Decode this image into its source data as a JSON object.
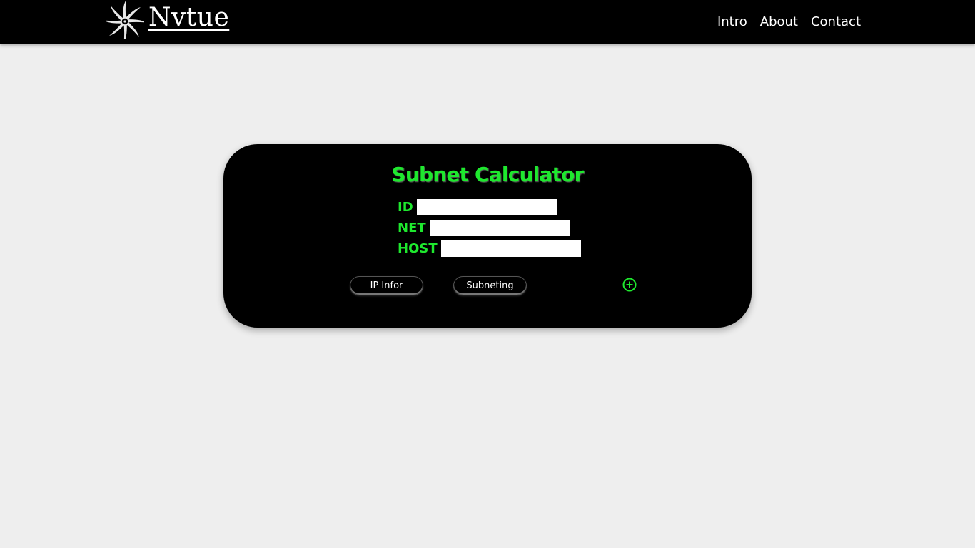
{
  "header": {
    "brand_name": "Nvtue",
    "nav": [
      {
        "label": "Intro"
      },
      {
        "label": "About"
      },
      {
        "label": "Contact"
      }
    ]
  },
  "calculator": {
    "title": "Subnet Calculator",
    "fields": [
      {
        "label": "ID",
        "value": ""
      },
      {
        "label": "NET",
        "value": ""
      },
      {
        "label": "HOST",
        "value": ""
      }
    ],
    "buttons": {
      "ip_info": "IP Infor",
      "subneting": "Subneting"
    },
    "add_icon": "plus-circle-icon"
  },
  "colors": {
    "accent": "#1ee82e",
    "page_background": "#eeeeee",
    "header_background": "#000000",
    "card_background": "#000000"
  }
}
